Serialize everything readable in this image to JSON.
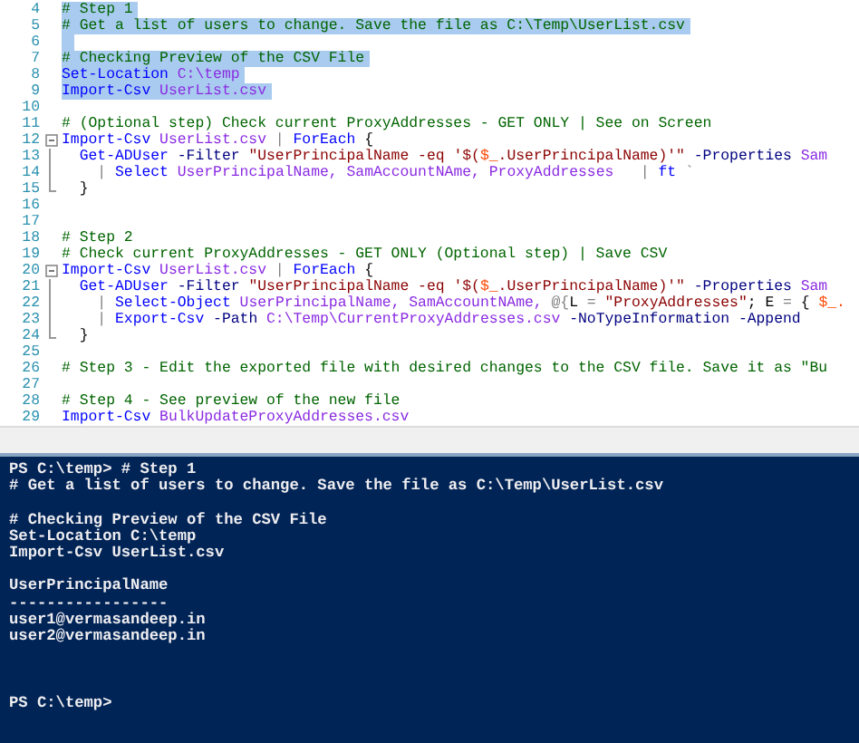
{
  "editor": {
    "lines": [
      {
        "number": "4",
        "selected": true,
        "kind": "plain",
        "tokens": [
          {
            "kind": "comment",
            "text": "# Step 1"
          }
        ]
      },
      {
        "number": "5",
        "selected": true,
        "kind": "plain",
        "tokens": [
          {
            "kind": "comment",
            "text": "# Get a list of users to change. Save the file as C:\\Temp\\UserList.csv"
          }
        ]
      },
      {
        "number": "6",
        "selected": true,
        "kind": "plain"
      },
      {
        "number": "7",
        "selected": true,
        "kind": "plain",
        "tokens": [
          {
            "kind": "comment",
            "text": "# Checking Preview of the CSV File"
          }
        ]
      },
      {
        "number": "8",
        "selected": true,
        "kind": "plain",
        "tokens": [
          {
            "kind": "cmdlet",
            "text": "Set-Location"
          },
          {
            "kind": "arg",
            "text": " C:\\temp"
          }
        ]
      },
      {
        "number": "9",
        "selected": true,
        "kind": "plain",
        "tokens": [
          {
            "kind": "cmdlet",
            "text": "Import-Csv"
          },
          {
            "kind": "arg",
            "text": " UserList.csv"
          }
        ]
      },
      {
        "number": "10",
        "selected": false,
        "kind": "plain"
      },
      {
        "number": "11",
        "selected": false,
        "kind": "plain",
        "tokens": [
          {
            "kind": "comment",
            "text": "# (Optional step) Check current ProxyAddresses - GET ONLY | See on Screen"
          }
        ]
      },
      {
        "number": "12",
        "selected": false,
        "kind": "fold-start",
        "tokens": [
          {
            "kind": "cmdlet",
            "text": "Import-Csv"
          },
          {
            "kind": "arg",
            "text": " UserList.csv"
          },
          {
            "kind": "op",
            "text": " |"
          },
          {
            "kind": "cmdlet",
            "text": " ForEach"
          },
          {
            "kind": "text",
            "text": " {"
          }
        ]
      },
      {
        "number": "13",
        "selected": false,
        "kind": "fold-body",
        "tokens": [
          {
            "kind": "cmdlet",
            "text": "  Get-ADUser"
          },
          {
            "kind": "param",
            "text": " -Filter"
          },
          {
            "kind": "string",
            "text": " \"UserPrincipalName -eq '$("
          },
          {
            "kind": "variable",
            "text": "$_"
          },
          {
            "kind": "string",
            "text": ".UserPrincipalName)'\""
          },
          {
            "kind": "param",
            "text": " -Properties"
          },
          {
            "kind": "arg",
            "text": " Sam"
          }
        ]
      },
      {
        "number": "14",
        "selected": false,
        "kind": "fold-body",
        "tokens": [
          {
            "kind": "op",
            "text": "    |"
          },
          {
            "kind": "cmdlet",
            "text": " Select"
          },
          {
            "kind": "arg",
            "text": " UserPrincipalName, SamAccountNAme, ProxyAddresses"
          },
          {
            "kind": "op",
            "text": "   |"
          },
          {
            "kind": "cmdlet",
            "text": " ft"
          },
          {
            "kind": "op",
            "text": " `"
          }
        ]
      },
      {
        "number": "15",
        "selected": false,
        "kind": "fold-end",
        "tokens": [
          {
            "kind": "text",
            "text": "  }"
          }
        ]
      },
      {
        "number": "16",
        "selected": false,
        "kind": "plain"
      },
      {
        "number": "17",
        "selected": false,
        "kind": "plain"
      },
      {
        "number": "18",
        "selected": false,
        "kind": "plain",
        "tokens": [
          {
            "kind": "comment",
            "text": "# Step 2"
          }
        ]
      },
      {
        "number": "19",
        "selected": false,
        "kind": "plain",
        "tokens": [
          {
            "kind": "comment",
            "text": "# Check current ProxyAddresses - GET ONLY (Optional step) | Save CSV"
          }
        ]
      },
      {
        "number": "20",
        "selected": false,
        "kind": "fold-start",
        "tokens": [
          {
            "kind": "cmdlet",
            "text": "Import-Csv"
          },
          {
            "kind": "arg",
            "text": " UserList.csv"
          },
          {
            "kind": "op",
            "text": " |"
          },
          {
            "kind": "cmdlet",
            "text": " ForEach"
          },
          {
            "kind": "text",
            "text": " {"
          }
        ]
      },
      {
        "number": "21",
        "selected": false,
        "kind": "fold-body",
        "tokens": [
          {
            "kind": "cmdlet",
            "text": "  Get-ADUser"
          },
          {
            "kind": "param",
            "text": " -Filter"
          },
          {
            "kind": "string",
            "text": " \"UserPrincipalName -eq '$("
          },
          {
            "kind": "variable",
            "text": "$_"
          },
          {
            "kind": "string",
            "text": ".UserPrincipalName)'\""
          },
          {
            "kind": "param",
            "text": " -Properties"
          },
          {
            "kind": "arg",
            "text": " Sam"
          }
        ]
      },
      {
        "number": "22",
        "selected": false,
        "kind": "fold-body",
        "tokens": [
          {
            "kind": "op",
            "text": "    |"
          },
          {
            "kind": "cmdlet",
            "text": " Select-Object"
          },
          {
            "kind": "arg",
            "text": " UserPrincipalName, SamAccountNAme,"
          },
          {
            "kind": "op",
            "text": " @{"
          },
          {
            "kind": "text",
            "text": "L"
          },
          {
            "kind": "op",
            "text": " ="
          },
          {
            "kind": "string",
            "text": " \"ProxyAddresses\""
          },
          {
            "kind": "text",
            "text": "; E"
          },
          {
            "kind": "op",
            "text": " ="
          },
          {
            "kind": "text",
            "text": " {"
          },
          {
            "kind": "variable",
            "text": " $_."
          }
        ]
      },
      {
        "number": "23",
        "selected": false,
        "kind": "fold-body",
        "tokens": [
          {
            "kind": "op",
            "text": "    |"
          },
          {
            "kind": "cmdlet",
            "text": " Export-Csv"
          },
          {
            "kind": "param",
            "text": " -Path"
          },
          {
            "kind": "arg",
            "text": " C:\\Temp\\CurrentProxyAddresses.csv"
          },
          {
            "kind": "param",
            "text": " -NoTypeInformation -Append"
          }
        ]
      },
      {
        "number": "24",
        "selected": false,
        "kind": "fold-end",
        "tokens": [
          {
            "kind": "text",
            "text": "  }"
          }
        ]
      },
      {
        "number": "25",
        "selected": false,
        "kind": "plain"
      },
      {
        "number": "26",
        "selected": false,
        "kind": "plain",
        "tokens": [
          {
            "kind": "comment",
            "text": "# Step 3 - Edit the exported file with desired changes to the CSV file. Save it as \"Bu"
          }
        ]
      },
      {
        "number": "27",
        "selected": false,
        "kind": "plain"
      },
      {
        "number": "28",
        "selected": false,
        "kind": "plain",
        "tokens": [
          {
            "kind": "comment",
            "text": "# Step 4 - See preview of the new file"
          }
        ]
      },
      {
        "number": "29",
        "selected": false,
        "kind": "plain",
        "tokens": [
          {
            "kind": "cmdlet",
            "text": "Import-Csv"
          },
          {
            "kind": "arg",
            "text": " BulkUpdateProxyAddresses.csv"
          }
        ]
      }
    ]
  },
  "console": {
    "blocks": [
      [
        "PS C:\\temp> # Step 1",
        "# Get a list of users to change. Save the file as C:\\Temp\\UserList.csv"
      ],
      [
        "# Checking Preview of the CSV File",
        "Set-Location C:\\temp",
        "Import-Csv UserList.csv"
      ],
      [
        "UserPrincipalName",
        "-----------------",
        "user1@vermasandeep.in",
        "user2@vermasandeep.in"
      ]
    ],
    "prompt": "PS C:\\temp>"
  }
}
